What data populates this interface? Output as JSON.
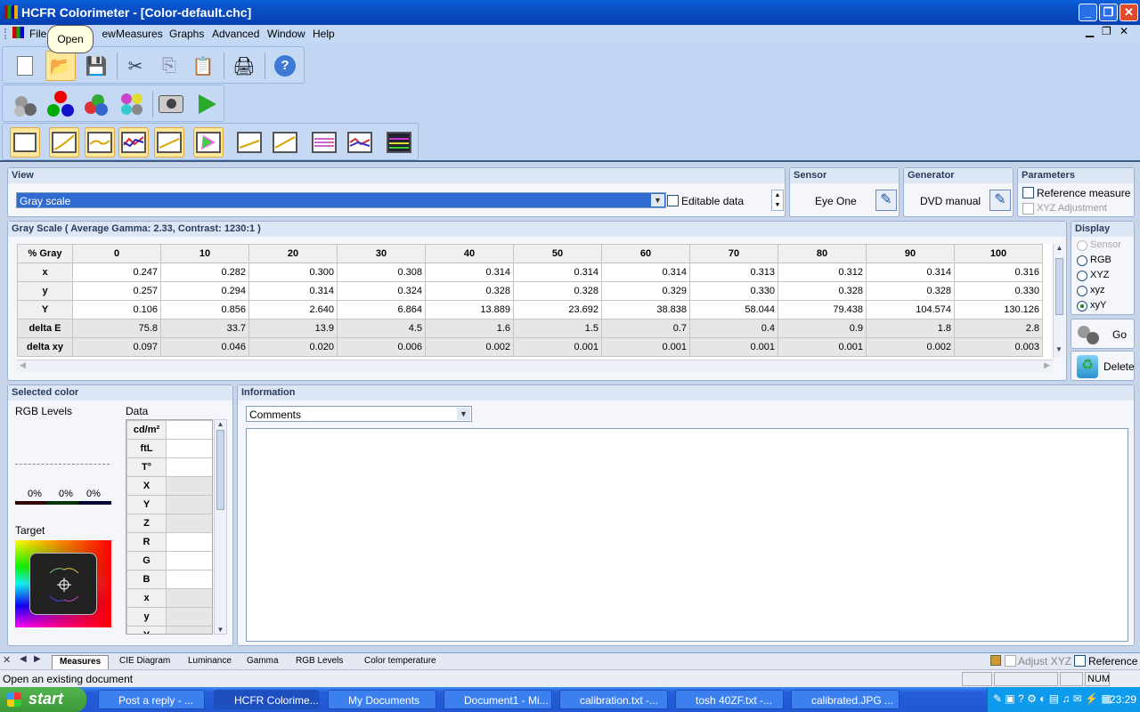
{
  "window": {
    "title": "HCFR Colorimeter - [Color-default.chc]"
  },
  "menu": [
    "File",
    "View",
    "Measures",
    "Graphs",
    "Advanced",
    "Window",
    "Help"
  ],
  "tooltip": "Open",
  "view": {
    "header": "View",
    "selected": "Gray scale",
    "editable_label": "Editable data"
  },
  "sensor": {
    "header": "Sensor",
    "value": "Eye One"
  },
  "generator": {
    "header": "Generator",
    "value": "DVD manual"
  },
  "parameters": {
    "header": "Parameters",
    "reference_measure": "Reference measure",
    "xyz_adjustment": "XYZ Adjustment"
  },
  "grayscale": {
    "header": "Gray Scale ( Average Gamma: 2.33, Contrast: 1230:1 )",
    "columns": [
      "% Gray",
      "0",
      "10",
      "20",
      "30",
      "40",
      "50",
      "60",
      "70",
      "80",
      "90",
      "100"
    ],
    "rows": [
      {
        "label": "x",
        "values": [
          "0.247",
          "0.282",
          "0.300",
          "0.308",
          "0.314",
          "0.314",
          "0.314",
          "0.313",
          "0.312",
          "0.314",
          "0.316"
        ]
      },
      {
        "label": "y",
        "values": [
          "0.257",
          "0.294",
          "0.314",
          "0.324",
          "0.328",
          "0.328",
          "0.329",
          "0.330",
          "0.328",
          "0.328",
          "0.330"
        ]
      },
      {
        "label": "Y",
        "values": [
          "0.106",
          "0.856",
          "2.640",
          "6.864",
          "13.889",
          "23.692",
          "38.838",
          "58.044",
          "79.438",
          "104.574",
          "130.126"
        ]
      },
      {
        "label": "delta E",
        "values": [
          "75.8",
          "33.7",
          "13.9",
          "4.5",
          "1.6",
          "1.5",
          "0.7",
          "0.4",
          "0.9",
          "1.8",
          "2.8"
        ]
      },
      {
        "label": "delta xy",
        "values": [
          "0.097",
          "0.046",
          "0.020",
          "0.006",
          "0.002",
          "0.001",
          "0.001",
          "0.001",
          "0.001",
          "0.002",
          "0.003"
        ]
      }
    ]
  },
  "display": {
    "header": "Display",
    "options": [
      "Sensor",
      "RGB",
      "XYZ",
      "xyz",
      "xyY"
    ],
    "selected": "xyY",
    "go": "Go",
    "delete": "Delete"
  },
  "selected_color": {
    "header": "Selected color",
    "rgb_levels": "RGB Levels",
    "data": "Data",
    "percents": [
      "0%",
      "0%",
      "0%"
    ],
    "target": "Target",
    "data_rows": [
      "cd/m²",
      "ftL",
      "T°",
      "X",
      "Y",
      "Z",
      "R",
      "G",
      "B",
      "x",
      "y",
      "Y"
    ]
  },
  "information": {
    "header": "Information",
    "dropdown": "Comments"
  },
  "tabs": [
    "Measures",
    "CIE Diagram",
    "Luminance",
    "Gamma",
    "RGB Levels",
    "Color temperature"
  ],
  "status": {
    "text": "Open an existing document",
    "adjust_xyz": "Adjust XYZ",
    "reference": "Reference",
    "num": "NUM"
  },
  "taskbar": {
    "start": "start",
    "items": [
      "Post a reply - ...",
      "HCFR Colorime...",
      "My Documents",
      "Document1 - Mi...",
      "calibration.txt -...",
      "tosh 40ZF.txt -...",
      "calibrated.JPG ..."
    ],
    "clock": "23:29"
  }
}
